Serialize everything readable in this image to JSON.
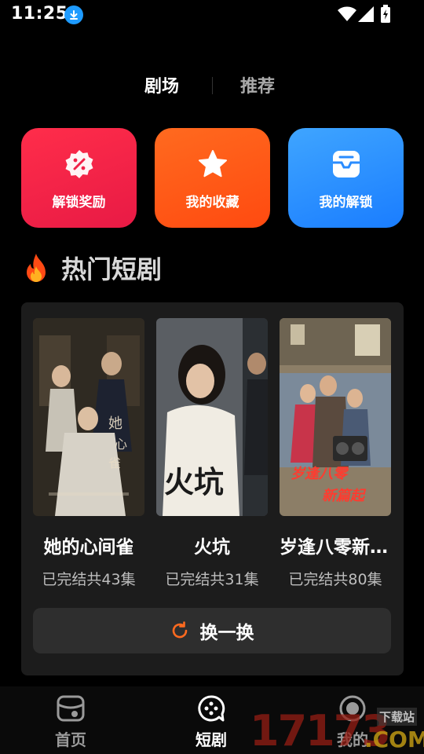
{
  "status_bar": {
    "time": "11:25",
    "icons": [
      "download-icon",
      "wifi-icon",
      "signal-icon",
      "battery-charging-icon"
    ]
  },
  "top_tabs": {
    "items": [
      {
        "label": "剧场",
        "active": true
      },
      {
        "label": "推荐",
        "active": false
      }
    ]
  },
  "quick_actions": [
    {
      "label": "解锁奖励",
      "icon": "discount-badge-icon",
      "color": "#f02248"
    },
    {
      "label": "我的收藏",
      "icon": "star-icon",
      "color": "#ff5a16"
    },
    {
      "label": "我的解锁",
      "icon": "inbox-icon",
      "color": "#2a8cff"
    }
  ],
  "hot_section": {
    "icon": "fire-icon",
    "title": "热门短剧",
    "dramas": [
      {
        "title": "她的心间雀",
        "meta": "已完结共43集"
      },
      {
        "title": "火坑",
        "meta": "已完结共31集"
      },
      {
        "title": "岁逢八零新篇起",
        "meta": "已完结共80集"
      }
    ],
    "refresh_label": "换一换"
  },
  "bottom_nav": {
    "items": [
      {
        "label": "首页",
        "icon": "theater-icon",
        "active": false
      },
      {
        "label": "短剧",
        "icon": "play-circle-icon",
        "active": true
      },
      {
        "label": "我的",
        "icon": "profile-icon",
        "active": false
      }
    ]
  },
  "watermark": {
    "digits": "17173",
    "domain": ".COM",
    "site": "下载站"
  }
}
